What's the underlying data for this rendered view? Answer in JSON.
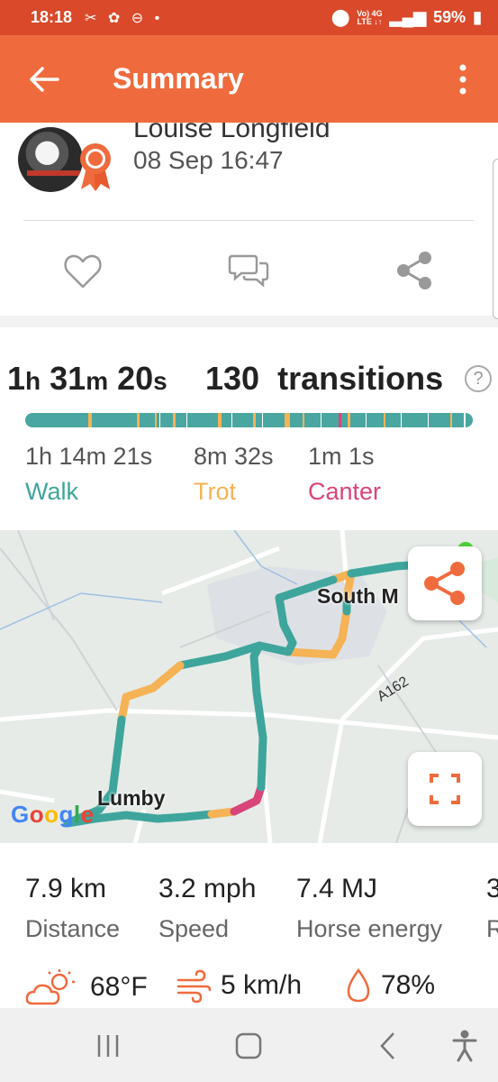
{
  "status_bar": {
    "time": "18:18",
    "network_top": "Vo) 4G",
    "network_bottom": "LTE ↓↑",
    "battery": "59%"
  },
  "app_bar": {
    "title": "Summary"
  },
  "ride": {
    "user_name": "Louise Longfield",
    "date": "08 Sep 16:47"
  },
  "stats": {
    "duration_h": "1",
    "duration_m": "31",
    "duration_s": "20",
    "unit_h": "h",
    "unit_m": "m",
    "unit_s": "s",
    "transitions_count": "130",
    "transitions_label": "transitions",
    "help_symbol": "?",
    "gaits": [
      {
        "time": "1h 14m 21s",
        "label": "Walk",
        "color": "#3ea59c"
      },
      {
        "time": "8m 32s",
        "label": "Trot",
        "color": "#f5b355"
      },
      {
        "time": "1m 1s",
        "label": "Canter",
        "color": "#d9457a"
      }
    ]
  },
  "map": {
    "labels": {
      "town_1": "South M",
      "town_2": "Lumby",
      "road": "A162"
    },
    "attribution": [
      "G",
      "o",
      "o",
      "g",
      "l",
      "e"
    ],
    "attribution_colors": [
      "#4285f4",
      "#ea4335",
      "#fbbc05",
      "#4285f4",
      "#34a853",
      "#ea4335"
    ]
  },
  "metrics": [
    {
      "value": "7.9 km",
      "label": "Distance"
    },
    {
      "value": "3.2 mph",
      "label": "Speed"
    },
    {
      "value": "7.4 MJ",
      "label": "Horse energy"
    },
    {
      "value": "3",
      "label": "R"
    }
  ],
  "weather": {
    "temperature": "68°F",
    "wind": "5 km/h",
    "humidity": "78%"
  },
  "colors": {
    "status_bar": "#d9492a",
    "accent": "#ef6b3e",
    "walk": "#3ea59c",
    "trot": "#f5b355",
    "canter": "#d9457a"
  },
  "icons": [
    "back-arrow-icon",
    "more-vert-icon",
    "rosette-icon",
    "heart-icon",
    "comment-icon",
    "share-icon",
    "help-icon",
    "map-share-icon",
    "fullscreen-icon",
    "weather-cloud-sun-icon",
    "wind-icon",
    "humidity-drop-icon"
  ]
}
